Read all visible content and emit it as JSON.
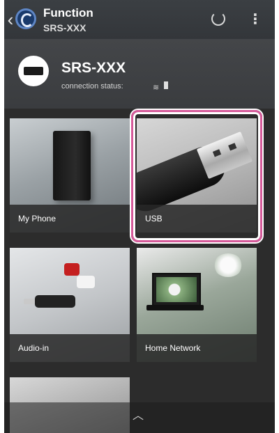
{
  "appbar": {
    "title": "Function",
    "subtitle": "SRS-XXX",
    "back_icon": "chevron-left-icon",
    "refresh_icon": "refresh-icon",
    "menu_icon": "overflow-menu-icon"
  },
  "device": {
    "name": "SRS-XXX",
    "status_label": "connection status:",
    "status_icons": [
      "wifi-icon",
      "battery-icon"
    ]
  },
  "functions": [
    {
      "label": "My Phone"
    },
    {
      "label": "USB",
      "highlighted": true
    },
    {
      "label": "Audio-in"
    },
    {
      "label": "Home Network"
    }
  ],
  "colors": {
    "highlight": "#d65a9a",
    "background": "#2b2b2b"
  }
}
